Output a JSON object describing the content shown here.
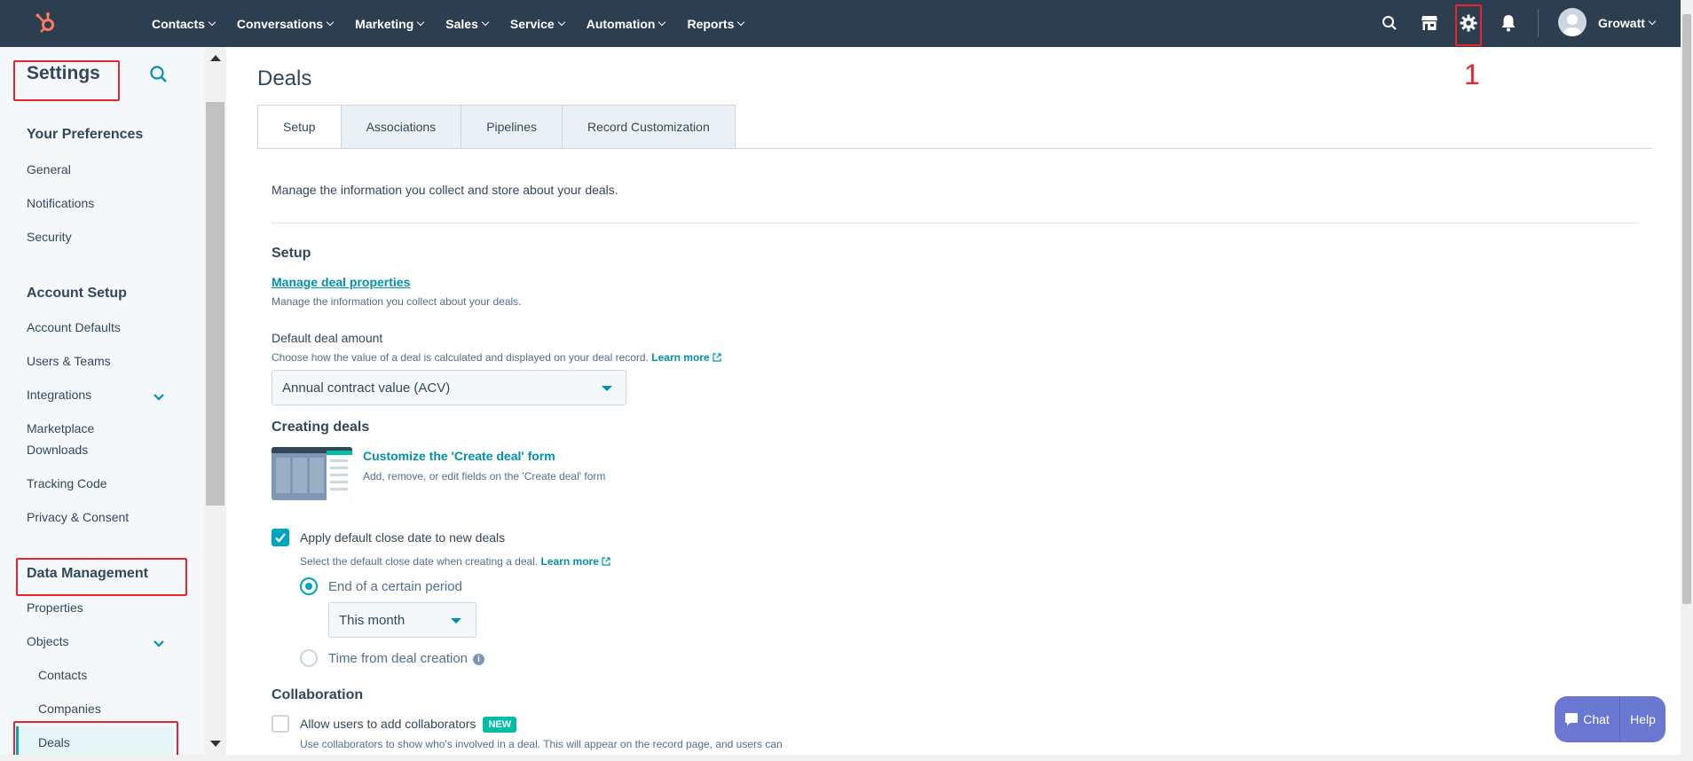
{
  "topnav": {
    "items": [
      {
        "label": "Contacts"
      },
      {
        "label": "Conversations"
      },
      {
        "label": "Marketing"
      },
      {
        "label": "Sales"
      },
      {
        "label": "Service"
      },
      {
        "label": "Automation"
      },
      {
        "label": "Reports"
      }
    ],
    "user_name": "Growatt",
    "annotation": "1"
  },
  "sidebar": {
    "title": "Settings",
    "sections": [
      {
        "heading": "Your Preferences",
        "items": [
          "General",
          "Notifications",
          "Security"
        ]
      },
      {
        "heading": "Account Setup",
        "items": [
          "Account Defaults",
          "Users & Teams",
          "Integrations",
          "Marketplace Downloads",
          "Tracking Code",
          "Privacy & Consent"
        ]
      },
      {
        "heading": "Data Management",
        "items": [
          "Properties",
          "Objects"
        ],
        "sub_items": [
          "Contacts",
          "Companies",
          "Deals"
        ]
      }
    ]
  },
  "main": {
    "title": "Deals",
    "tabs": [
      {
        "label": "Setup",
        "active": true
      },
      {
        "label": "Associations"
      },
      {
        "label": "Pipelines"
      },
      {
        "label": "Record Customization"
      }
    ],
    "intro": "Manage the information you collect and store about your deals.",
    "setup": {
      "heading": "Setup",
      "manage_link": "Manage deal properties",
      "manage_help": "Manage the information you collect about your deals.",
      "amount_label": "Default deal amount",
      "amount_help": "Choose how the value of a deal is calculated and displayed on your deal record.",
      "learn_more": "Learn more",
      "amount_value": "Annual contract value (ACV)"
    },
    "creating": {
      "heading": "Creating deals",
      "title": "Customize the 'Create deal' form",
      "desc": "Add, remove, or edit fields on the 'Create deal' form"
    },
    "close_date": {
      "checkbox_label": "Apply default close date to new deals",
      "checked": true,
      "help": "Select the default close date when creating a deal.",
      "learn_more": "Learn more",
      "radio1": "End of a certain period",
      "period_value": "This month",
      "radio2": "Time from deal creation"
    },
    "collaboration": {
      "heading": "Collaboration",
      "checkbox_label": "Allow users to add collaborators",
      "badge": "NEW",
      "help": "Use collaborators to show who's involved in a deal. This will appear on the record page, and users can"
    }
  },
  "widget": {
    "chat": "Chat",
    "help": "Help"
  },
  "colors": {
    "topbar": "#2d3e50",
    "accent": "#00a4bd",
    "link": "#0091ae",
    "highlight": "#e8252f"
  }
}
